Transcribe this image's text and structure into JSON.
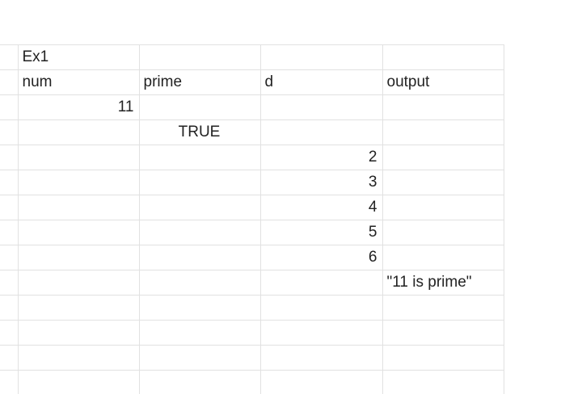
{
  "sheet": {
    "rows": [
      [
        "",
        "Ex1",
        "",
        "",
        ""
      ],
      [
        "",
        "num",
        "prime",
        "d",
        "output"
      ],
      [
        "",
        "11",
        "",
        "",
        ""
      ],
      [
        "",
        "",
        "TRUE",
        "",
        ""
      ],
      [
        "",
        "",
        "",
        "2",
        ""
      ],
      [
        "",
        "",
        "",
        "3",
        ""
      ],
      [
        "",
        "",
        "",
        "4",
        ""
      ],
      [
        "",
        "",
        "",
        "5",
        ""
      ],
      [
        "",
        "",
        "",
        "6",
        ""
      ],
      [
        "",
        "",
        "",
        "",
        "\"11 is prime\""
      ],
      [
        "",
        "",
        "",
        "",
        ""
      ],
      [
        "",
        "",
        "",
        "",
        ""
      ],
      [
        "",
        "",
        "",
        "",
        ""
      ],
      [
        "",
        "",
        "",
        "",
        ""
      ]
    ],
    "alignments": [
      [
        "txt",
        "txt",
        "txt",
        "txt",
        "txt"
      ],
      [
        "txt",
        "txt",
        "txt",
        "txt",
        "txt"
      ],
      [
        "txt",
        "num",
        "txt",
        "txt",
        "txt"
      ],
      [
        "txt",
        "txt",
        "bool",
        "txt",
        "txt"
      ],
      [
        "txt",
        "txt",
        "txt",
        "num",
        "txt"
      ],
      [
        "txt",
        "txt",
        "txt",
        "num",
        "txt"
      ],
      [
        "txt",
        "txt",
        "txt",
        "num",
        "txt"
      ],
      [
        "txt",
        "txt",
        "txt",
        "num",
        "txt"
      ],
      [
        "txt",
        "txt",
        "txt",
        "num",
        "txt"
      ],
      [
        "txt",
        "txt",
        "txt",
        "txt",
        "txt"
      ],
      [
        "txt",
        "txt",
        "txt",
        "txt",
        "txt"
      ],
      [
        "txt",
        "txt",
        "txt",
        "txt",
        "txt"
      ],
      [
        "txt",
        "txt",
        "txt",
        "txt",
        "txt"
      ],
      [
        "txt",
        "txt",
        "txt",
        "txt",
        "txt"
      ]
    ]
  }
}
